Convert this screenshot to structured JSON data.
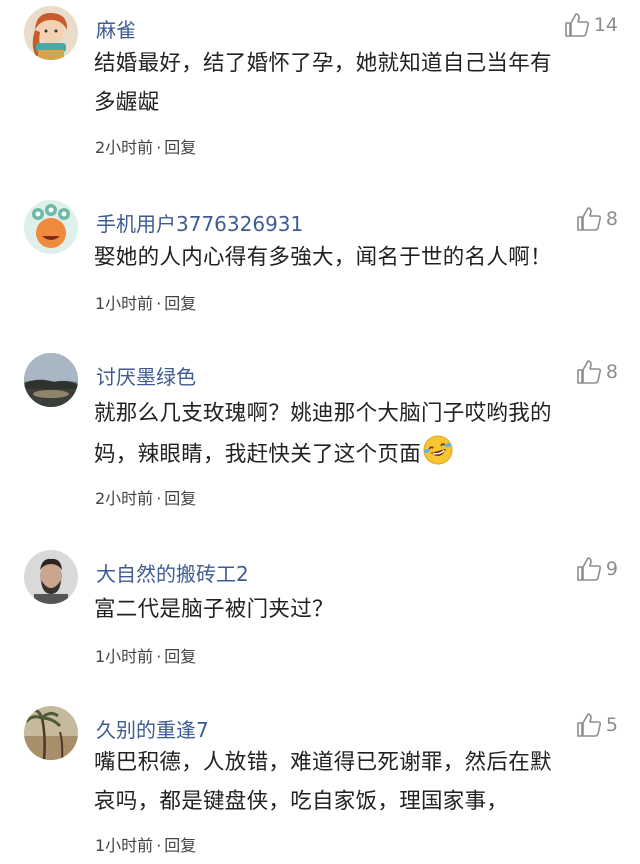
{
  "comments": [
    {
      "user": "麻雀",
      "likes": "14",
      "lines": [
        "结婚最好，结了婚怀了孕，她就知道自己当年有",
        "多龌龊"
      ],
      "time": "2小时前",
      "reply": "回复"
    },
    {
      "user": "手机用户3776326931",
      "likes": "8",
      "lines": [
        "娶她的人内心得有多強大，闻名于世的名人啊！"
      ],
      "time": "1小时前",
      "reply": "回复"
    },
    {
      "user": "讨厌墨绿色",
      "likes": "8",
      "lines": [
        "就那么几支玫瑰啊？姚迪那个大脑门子哎哟我的",
        "妈，辣眼睛，我赶快关了这个页面"
      ],
      "emoji": "laughing-crying-emoji",
      "time": "2小时前",
      "reply": "回复"
    },
    {
      "user": "大自然的搬砖工2",
      "likes": "9",
      "lines": [
        "富二代是脑子被门夹过？"
      ],
      "time": "1小时前",
      "reply": "回复"
    },
    {
      "user": "久别的重逢7",
      "likes": "5",
      "lines": [
        "嘴巴积德，人放错，难道得已死谢罪，然后在默",
        "哀吗，都是键盘侠，吃自家饭，理国家事，"
      ],
      "time": "1小时前",
      "reply": "回复"
    }
  ],
  "separator": "·",
  "icons": {
    "like": "thumbs-up-icon"
  }
}
